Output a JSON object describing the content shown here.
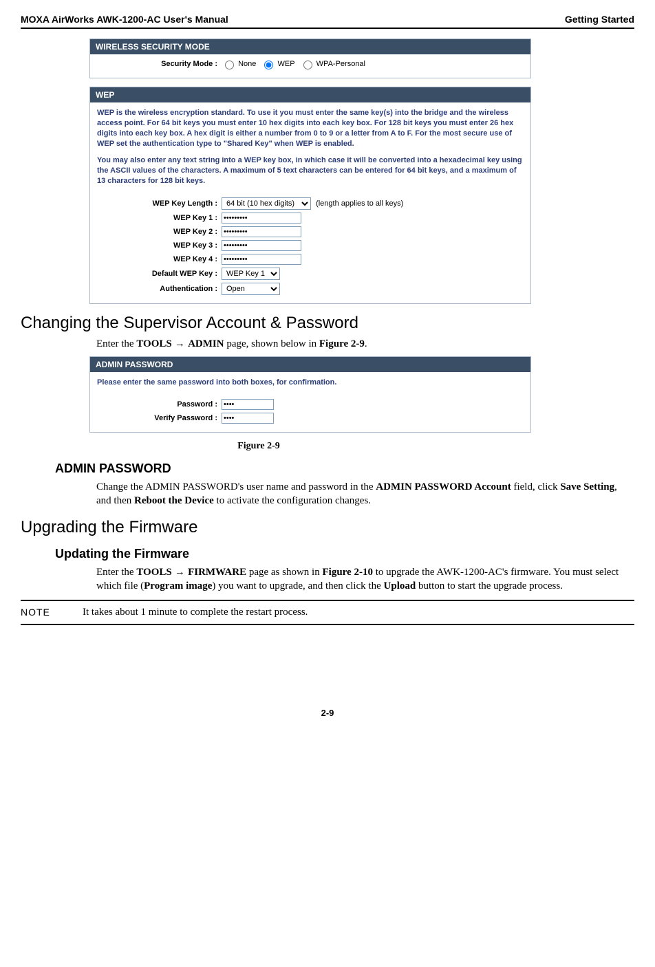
{
  "header": {
    "left": "MOXA AirWorks AWK-1200-AC User's Manual",
    "right": "Getting Started"
  },
  "panel1": {
    "title": "WIRELESS SECURITY MODE",
    "mode_label": "Security Mode :",
    "options": {
      "none": "None",
      "wep": "WEP",
      "wpa": "WPA-Personal"
    }
  },
  "panel2": {
    "title": "WEP",
    "intro1": "WEP is the wireless encryption standard. To use it you must enter the same key(s) into the bridge and the wireless access point. For 64 bit keys you must enter 10 hex digits into each key box. For 128 bit keys you must enter 26 hex digits into each key box. A hex digit is either a number from 0 to 9 or a letter from A to F. For the most secure use of WEP set the authentication type to \"Shared Key\" when WEP is enabled.",
    "intro2": "You may also enter any text string into a WEP key box, in which case it will be converted into a hexadecimal key using the ASCII values of the characters. A maximum of 5 text characters can be entered for 64 bit keys, and a maximum of 13 characters for 128 bit keys.",
    "labels": {
      "len": "WEP Key Length :",
      "k1": "WEP Key 1 :",
      "k2": "WEP Key 2 :",
      "k3": "WEP Key 3 :",
      "k4": "WEP Key 4 :",
      "def": "Default WEP Key :",
      "auth": "Authentication :"
    },
    "values": {
      "len": "64 bit (10 hex digits)",
      "len_hint": "(length applies to all keys)",
      "key": "•••••••••",
      "def": "WEP Key 1",
      "auth": "Open"
    }
  },
  "section1": {
    "title": "Changing the Supervisor Account & Password",
    "para_pre": "Enter the ",
    "para_b1": "TOOLS",
    "para_arrow": " → ",
    "para_b2": "ADMIN",
    "para_mid": " page, shown below in ",
    "para_b3": "Figure 2-9",
    "para_end": "."
  },
  "panel3": {
    "title": "ADMIN PASSWORD",
    "intro": "Please enter the same password into both boxes, for confirmation.",
    "labels": {
      "pw": "Password :",
      "vpw": "Verify Password :"
    },
    "value": "••••"
  },
  "figcap": "Figure 2-9",
  "sub1": {
    "title": "ADMIN PASSWORD",
    "p_pre": "Change the ADMIN PASSWORD's user name and password in the ",
    "b1": "ADMIN PASSWORD Account",
    "p2": " field, click ",
    "b2": "Save Setting",
    "p3": ", and then ",
    "b3": "Reboot the Device",
    "p4": " to activate the configuration changes."
  },
  "section2": {
    "title": "Upgrading the Firmware"
  },
  "sub2": {
    "title": "Updating the Firmware",
    "p_pre": "Enter the ",
    "b1": "TOOLS",
    "arrow": " → ",
    "b2": "FIRMWARE",
    "p2": " page as shown in ",
    "b3": "Figure 2-10",
    "p3": " to upgrade the AWK-1200-AC's firmware. You must select which file (",
    "b4": "Program image",
    "p4": ") you want to upgrade, and then click the ",
    "b5": "Upload",
    "p5": " button to start the upgrade process."
  },
  "note": {
    "label": "NOTE",
    "text": "It takes about 1 minute to complete the restart process."
  },
  "pagenum": "2-9"
}
